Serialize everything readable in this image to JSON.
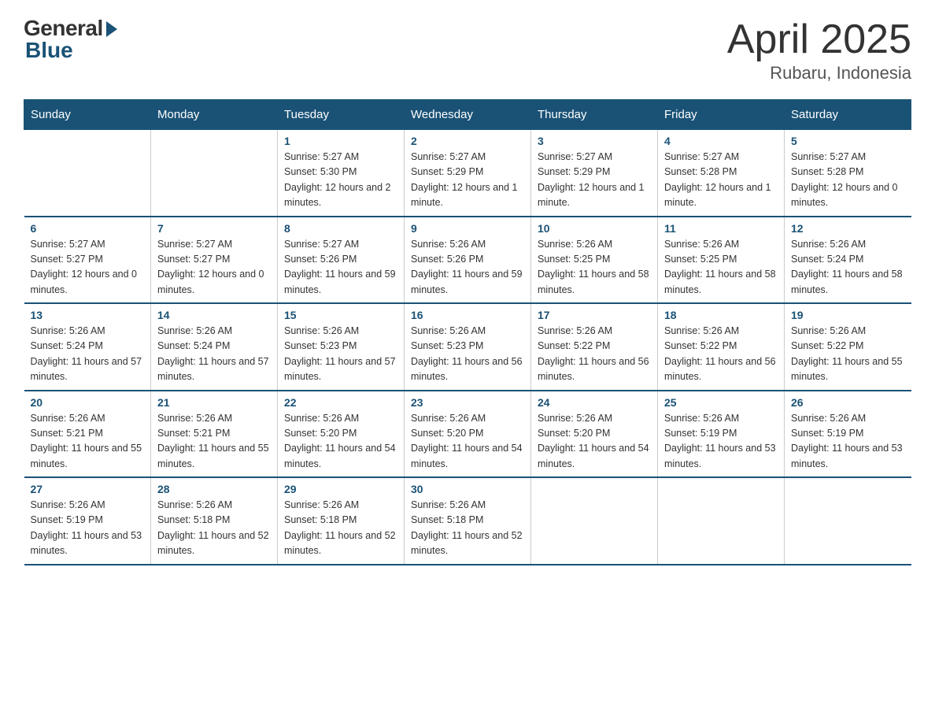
{
  "logo": {
    "general": "General",
    "blue": "Blue"
  },
  "title": "April 2025",
  "subtitle": "Rubaru, Indonesia",
  "headers": [
    "Sunday",
    "Monday",
    "Tuesday",
    "Wednesday",
    "Thursday",
    "Friday",
    "Saturday"
  ],
  "weeks": [
    [
      {
        "day": "",
        "sunrise": "",
        "sunset": "",
        "daylight": ""
      },
      {
        "day": "",
        "sunrise": "",
        "sunset": "",
        "daylight": ""
      },
      {
        "day": "1",
        "sunrise": "Sunrise: 5:27 AM",
        "sunset": "Sunset: 5:30 PM",
        "daylight": "Daylight: 12 hours and 2 minutes."
      },
      {
        "day": "2",
        "sunrise": "Sunrise: 5:27 AM",
        "sunset": "Sunset: 5:29 PM",
        "daylight": "Daylight: 12 hours and 1 minute."
      },
      {
        "day": "3",
        "sunrise": "Sunrise: 5:27 AM",
        "sunset": "Sunset: 5:29 PM",
        "daylight": "Daylight: 12 hours and 1 minute."
      },
      {
        "day": "4",
        "sunrise": "Sunrise: 5:27 AM",
        "sunset": "Sunset: 5:28 PM",
        "daylight": "Daylight: 12 hours and 1 minute."
      },
      {
        "day": "5",
        "sunrise": "Sunrise: 5:27 AM",
        "sunset": "Sunset: 5:28 PM",
        "daylight": "Daylight: 12 hours and 0 minutes."
      }
    ],
    [
      {
        "day": "6",
        "sunrise": "Sunrise: 5:27 AM",
        "sunset": "Sunset: 5:27 PM",
        "daylight": "Daylight: 12 hours and 0 minutes."
      },
      {
        "day": "7",
        "sunrise": "Sunrise: 5:27 AM",
        "sunset": "Sunset: 5:27 PM",
        "daylight": "Daylight: 12 hours and 0 minutes."
      },
      {
        "day": "8",
        "sunrise": "Sunrise: 5:27 AM",
        "sunset": "Sunset: 5:26 PM",
        "daylight": "Daylight: 11 hours and 59 minutes."
      },
      {
        "day": "9",
        "sunrise": "Sunrise: 5:26 AM",
        "sunset": "Sunset: 5:26 PM",
        "daylight": "Daylight: 11 hours and 59 minutes."
      },
      {
        "day": "10",
        "sunrise": "Sunrise: 5:26 AM",
        "sunset": "Sunset: 5:25 PM",
        "daylight": "Daylight: 11 hours and 58 minutes."
      },
      {
        "day": "11",
        "sunrise": "Sunrise: 5:26 AM",
        "sunset": "Sunset: 5:25 PM",
        "daylight": "Daylight: 11 hours and 58 minutes."
      },
      {
        "day": "12",
        "sunrise": "Sunrise: 5:26 AM",
        "sunset": "Sunset: 5:24 PM",
        "daylight": "Daylight: 11 hours and 58 minutes."
      }
    ],
    [
      {
        "day": "13",
        "sunrise": "Sunrise: 5:26 AM",
        "sunset": "Sunset: 5:24 PM",
        "daylight": "Daylight: 11 hours and 57 minutes."
      },
      {
        "day": "14",
        "sunrise": "Sunrise: 5:26 AM",
        "sunset": "Sunset: 5:24 PM",
        "daylight": "Daylight: 11 hours and 57 minutes."
      },
      {
        "day": "15",
        "sunrise": "Sunrise: 5:26 AM",
        "sunset": "Sunset: 5:23 PM",
        "daylight": "Daylight: 11 hours and 57 minutes."
      },
      {
        "day": "16",
        "sunrise": "Sunrise: 5:26 AM",
        "sunset": "Sunset: 5:23 PM",
        "daylight": "Daylight: 11 hours and 56 minutes."
      },
      {
        "day": "17",
        "sunrise": "Sunrise: 5:26 AM",
        "sunset": "Sunset: 5:22 PM",
        "daylight": "Daylight: 11 hours and 56 minutes."
      },
      {
        "day": "18",
        "sunrise": "Sunrise: 5:26 AM",
        "sunset": "Sunset: 5:22 PM",
        "daylight": "Daylight: 11 hours and 56 minutes."
      },
      {
        "day": "19",
        "sunrise": "Sunrise: 5:26 AM",
        "sunset": "Sunset: 5:22 PM",
        "daylight": "Daylight: 11 hours and 55 minutes."
      }
    ],
    [
      {
        "day": "20",
        "sunrise": "Sunrise: 5:26 AM",
        "sunset": "Sunset: 5:21 PM",
        "daylight": "Daylight: 11 hours and 55 minutes."
      },
      {
        "day": "21",
        "sunrise": "Sunrise: 5:26 AM",
        "sunset": "Sunset: 5:21 PM",
        "daylight": "Daylight: 11 hours and 55 minutes."
      },
      {
        "day": "22",
        "sunrise": "Sunrise: 5:26 AM",
        "sunset": "Sunset: 5:20 PM",
        "daylight": "Daylight: 11 hours and 54 minutes."
      },
      {
        "day": "23",
        "sunrise": "Sunrise: 5:26 AM",
        "sunset": "Sunset: 5:20 PM",
        "daylight": "Daylight: 11 hours and 54 minutes."
      },
      {
        "day": "24",
        "sunrise": "Sunrise: 5:26 AM",
        "sunset": "Sunset: 5:20 PM",
        "daylight": "Daylight: 11 hours and 54 minutes."
      },
      {
        "day": "25",
        "sunrise": "Sunrise: 5:26 AM",
        "sunset": "Sunset: 5:19 PM",
        "daylight": "Daylight: 11 hours and 53 minutes."
      },
      {
        "day": "26",
        "sunrise": "Sunrise: 5:26 AM",
        "sunset": "Sunset: 5:19 PM",
        "daylight": "Daylight: 11 hours and 53 minutes."
      }
    ],
    [
      {
        "day": "27",
        "sunrise": "Sunrise: 5:26 AM",
        "sunset": "Sunset: 5:19 PM",
        "daylight": "Daylight: 11 hours and 53 minutes."
      },
      {
        "day": "28",
        "sunrise": "Sunrise: 5:26 AM",
        "sunset": "Sunset: 5:18 PM",
        "daylight": "Daylight: 11 hours and 52 minutes."
      },
      {
        "day": "29",
        "sunrise": "Sunrise: 5:26 AM",
        "sunset": "Sunset: 5:18 PM",
        "daylight": "Daylight: 11 hours and 52 minutes."
      },
      {
        "day": "30",
        "sunrise": "Sunrise: 5:26 AM",
        "sunset": "Sunset: 5:18 PM",
        "daylight": "Daylight: 11 hours and 52 minutes."
      },
      {
        "day": "",
        "sunrise": "",
        "sunset": "",
        "daylight": ""
      },
      {
        "day": "",
        "sunrise": "",
        "sunset": "",
        "daylight": ""
      },
      {
        "day": "",
        "sunrise": "",
        "sunset": "",
        "daylight": ""
      }
    ]
  ]
}
